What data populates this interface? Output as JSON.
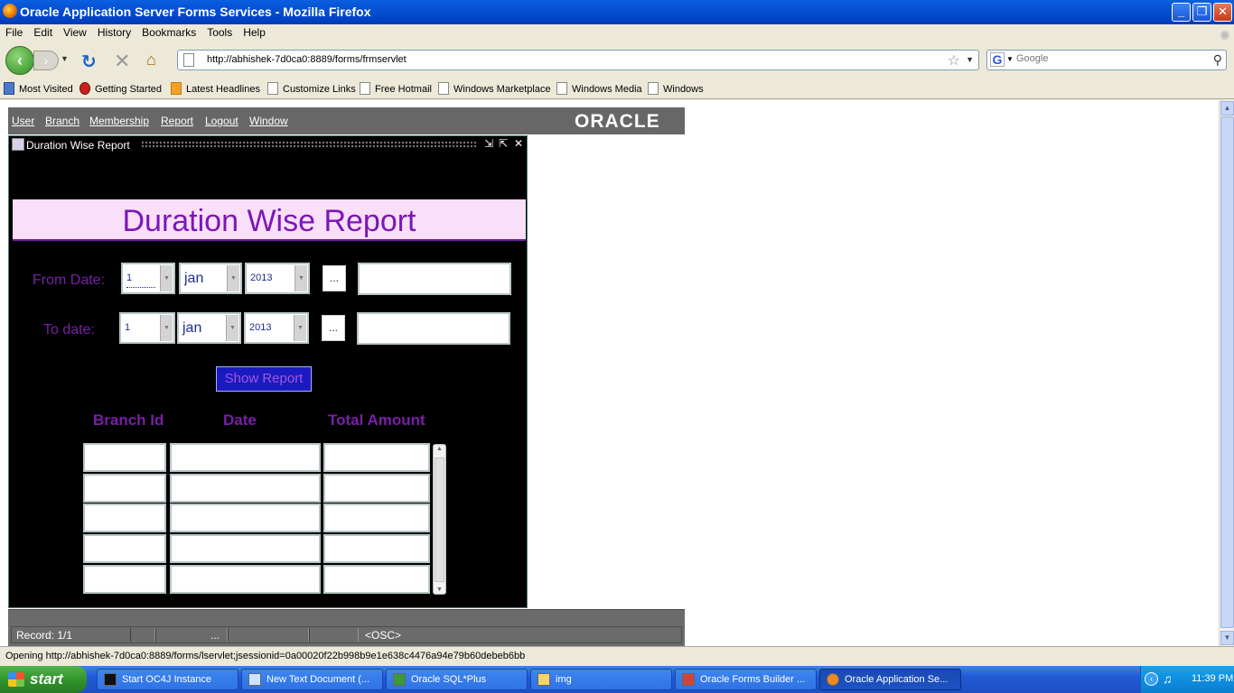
{
  "window": {
    "title": "Oracle Application Server Forms Services - Mozilla Firefox",
    "minimize": "_",
    "maximize": "❐",
    "close": "✕"
  },
  "menubar": [
    "File",
    "Edit",
    "View",
    "History",
    "Bookmarks",
    "Tools",
    "Help"
  ],
  "nav": {
    "url": "http://abhishek-7d0ca0:8889/forms/frmservlet",
    "search_placeholder": "Google"
  },
  "bookmarks": [
    "Most Visited",
    "Getting Started",
    "Latest Headlines",
    "Customize Links",
    "Free Hotmail",
    "Windows Marketplace",
    "Windows Media",
    "Windows"
  ],
  "applet": {
    "menu": [
      "User",
      "Branch",
      "Membership",
      "Report",
      "Logout",
      "Window"
    ],
    "logo": "ORACLE",
    "form_window_title": "Duration Wise Report",
    "heading": "Duration Wise Report",
    "from": {
      "label": "From Date:",
      "day": "1",
      "month": "jan",
      "year": "2013",
      "button": "..."
    },
    "to": {
      "label": "To date:",
      "day": "1",
      "month": "jan",
      "year": "2013",
      "button": "..."
    },
    "show_report": "Show Report",
    "columns": [
      "Branch Id",
      "Date",
      "Total Amount"
    ],
    "rows": [
      [
        "",
        "",
        ""
      ],
      [
        "",
        "",
        ""
      ],
      [
        "",
        "",
        ""
      ],
      [
        "",
        "",
        ""
      ],
      [
        "",
        "",
        ""
      ]
    ],
    "status": {
      "record": "Record: 1/1",
      "ellipsis": "...",
      "osc": "<OSC>"
    }
  },
  "browser_status": "Opening http://abhishek-7d0ca0:8889/forms/lservlet;jsessionid=0a00020f22b998b9e1e638c4476a94e79b60debeb6bb",
  "taskbar": {
    "start": "start",
    "tasks": [
      "Start OC4J Instance",
      "New Text Document (...",
      "Oracle SQL*Plus",
      "img",
      "Oracle Forms Builder ...",
      "Oracle Application Se..."
    ],
    "clock": "11:39 PM"
  }
}
